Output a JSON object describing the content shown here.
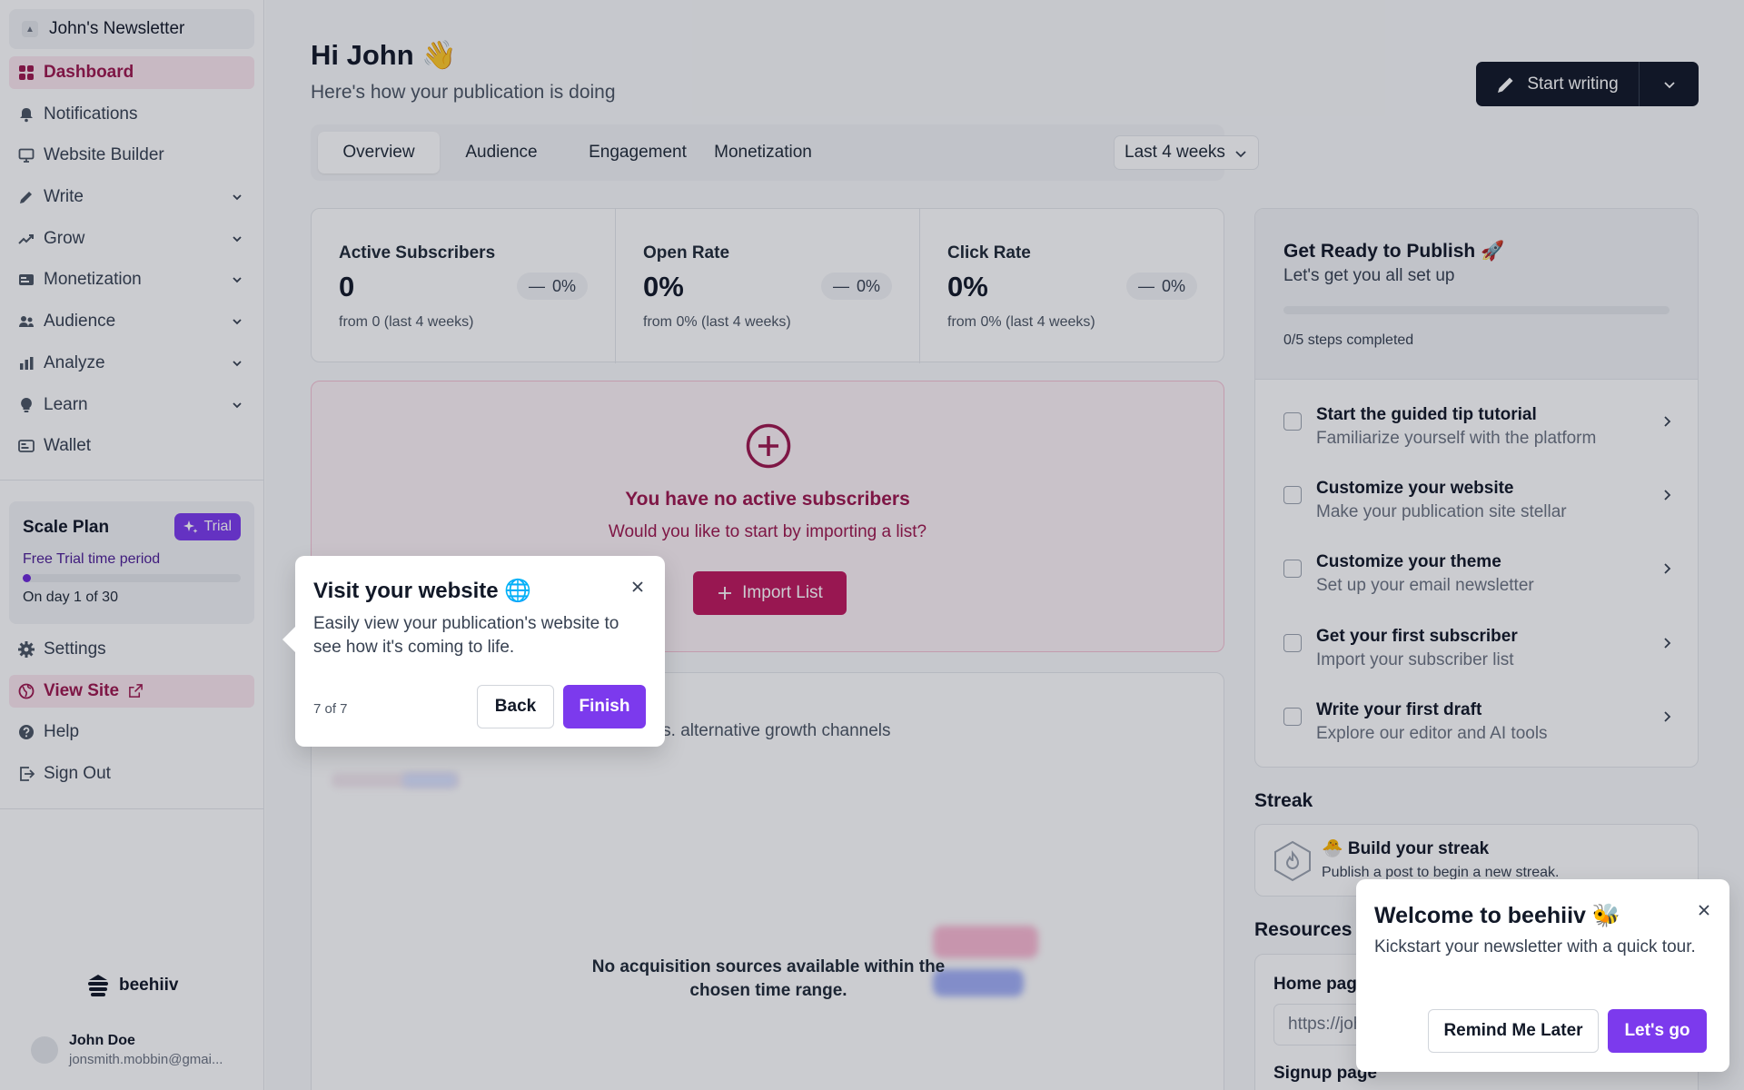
{
  "sidebar": {
    "publication": "John's Newsletter",
    "nav": [
      {
        "label": "Dashboard",
        "icon": "grid-icon",
        "active": true
      },
      {
        "label": "Notifications",
        "icon": "bell-icon"
      },
      {
        "label": "Website Builder",
        "icon": "monitor-icon"
      },
      {
        "label": "Write",
        "icon": "pencil-icon",
        "expandable": true
      },
      {
        "label": "Grow",
        "icon": "trend-up-icon",
        "expandable": true
      },
      {
        "label": "Monetization",
        "icon": "money-icon",
        "expandable": true
      },
      {
        "label": "Audience",
        "icon": "users-icon",
        "expandable": true
      },
      {
        "label": "Analyze",
        "icon": "bar-chart-icon",
        "expandable": true
      },
      {
        "label": "Learn",
        "icon": "lightbulb-icon",
        "expandable": true
      },
      {
        "label": "Wallet",
        "icon": "wallet-icon"
      }
    ],
    "plan": {
      "name": "Scale Plan",
      "badge": "Trial",
      "period_label": "Free Trial time period",
      "progress": 0.033,
      "day_label": "On day 1 of 30"
    },
    "nav2": [
      {
        "label": "Settings",
        "icon": "gear-icon"
      },
      {
        "label": "View Site",
        "icon": "globe-icon"
      },
      {
        "label": "Help",
        "icon": "help-icon"
      },
      {
        "label": "Sign Out",
        "icon": "sign-out-icon"
      }
    ],
    "brand": "beehiiv",
    "user": {
      "name": "John Doe",
      "email": "jonsmith.mobbin@gmai..."
    }
  },
  "header": {
    "greeting": "Hi John 👋",
    "subtitle": "Here's how your publication is doing",
    "start_writing": "Start writing"
  },
  "tabs": {
    "items": [
      "Overview",
      "Audience",
      "Engagement",
      "Monetization"
    ],
    "active": "Overview",
    "range": "Last 4 weeks"
  },
  "stats": [
    {
      "label": "Active Subscribers",
      "value": "0",
      "delta": "0%",
      "from": "from 0 (last 4 weeks)"
    },
    {
      "label": "Open Rate",
      "value": "0%",
      "delta": "0%",
      "from": "from 0% (last 4 weeks)"
    },
    {
      "label": "Click Rate",
      "value": "0%",
      "delta": "0%",
      "from": "from 0% (last 4 weeks)"
    }
  ],
  "empty_state": {
    "title": "You have no active subscribers",
    "subtitle": "Would you like to start by importing a list?",
    "button": "Import List"
  },
  "acquisition": {
    "subtitle": "ork vs. alternative growth channels",
    "empty": "No acquisition sources available within the chosen time range."
  },
  "ready": {
    "title": "Get Ready to Publish 🚀",
    "subtitle": "Let's get you all set up",
    "progress": 0,
    "steps_label": "0/5 steps completed",
    "steps": [
      {
        "title": "Start the guided tip tutorial",
        "desc": "Familiarize yourself with the platform"
      },
      {
        "title": "Customize your website",
        "desc": "Make your publication site stellar"
      },
      {
        "title": "Customize your theme",
        "desc": "Set up your email newsletter"
      },
      {
        "title": "Get your first subscriber",
        "desc": "Import your subscriber list"
      },
      {
        "title": "Write your first draft",
        "desc": "Explore our editor and AI tools"
      }
    ]
  },
  "streak": {
    "heading": "Streak",
    "title": "🐣 Build your streak",
    "subtitle": "Publish a post to begin a new streak."
  },
  "resources": {
    "heading": "Resources",
    "home_page": "Home page",
    "url": "https://john",
    "signup_page": "Signup page"
  },
  "tour": {
    "title": "Visit your website 🌐",
    "body": "Easily view your publication's website to see how it's coming to life.",
    "counter": "7 of 7",
    "back": "Back",
    "finish": "Finish"
  },
  "welcome": {
    "title": "Welcome to beehiiv 🐝",
    "body": "Kickstart your newsletter with a quick tour.",
    "remind": "Remind Me Later",
    "go": "Let's go"
  },
  "colors": {
    "accent": "#9d174d",
    "purple": "#7c3aed",
    "dark": "#111827"
  }
}
